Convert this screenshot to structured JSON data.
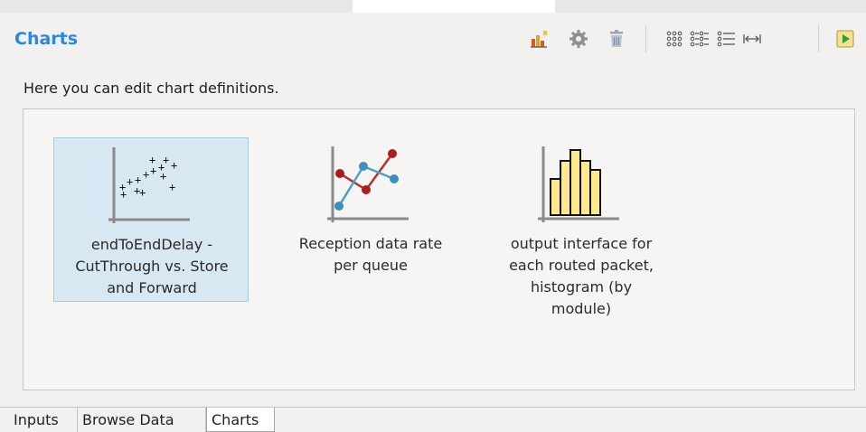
{
  "header": {
    "title": "Charts",
    "toolbar": [
      {
        "name": "new-chart-icon"
      },
      {
        "name": "settings-gear-icon"
      },
      {
        "name": "delete-trash-icon"
      },
      {
        "name": "icon-view-icon"
      },
      {
        "name": "multi-column-list-view-icon"
      },
      {
        "name": "list-view-icon"
      },
      {
        "name": "fit-width-icon"
      },
      {
        "name": "run-play-icon"
      }
    ]
  },
  "description": "Here you can edit chart definitions.",
  "charts": [
    {
      "label": [
        "endToEndDelay -",
        "CutThrough vs. Store",
        "and Forward"
      ],
      "icon": "scatter-chart-icon",
      "selected": true
    },
    {
      "label": [
        "Reception data rate",
        "per queue"
      ],
      "icon": "line-chart-icon",
      "selected": false
    },
    {
      "label": [
        "output interface for",
        "each routed packet,",
        "histogram (by",
        "module)"
      ],
      "icon": "histogram-chart-icon",
      "selected": false
    }
  ],
  "tabs": [
    {
      "label": "Inputs",
      "active": false
    },
    {
      "label": "Browse Data",
      "active": false
    },
    {
      "label": "Charts",
      "active": true
    }
  ],
  "colors": {
    "accent": "#2f86de",
    "selection": "#d8e8f2",
    "histogram_fill": "#ffe98c"
  }
}
